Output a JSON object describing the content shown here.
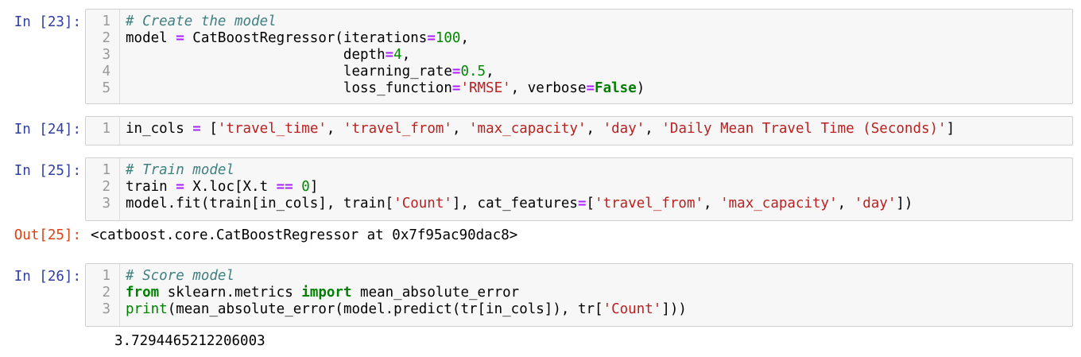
{
  "cells": {
    "c23": {
      "prompt": "In [23]:",
      "lines": [
        {
          "no": "1",
          "tokens": [
            {
              "t": "# Create the model",
              "c": "c-com"
            }
          ]
        },
        {
          "no": "2",
          "tokens": [
            {
              "t": "model ",
              "c": ""
            },
            {
              "t": "=",
              "c": "c-op"
            },
            {
              "t": " CatBoostRegressor(iterations",
              "c": ""
            },
            {
              "t": "=",
              "c": "c-op"
            },
            {
              "t": "100",
              "c": "c-num"
            },
            {
              "t": ",",
              "c": ""
            }
          ]
        },
        {
          "no": "3",
          "tokens": [
            {
              "t": "                          depth",
              "c": ""
            },
            {
              "t": "=",
              "c": "c-op"
            },
            {
              "t": "4",
              "c": "c-num"
            },
            {
              "t": ",",
              "c": ""
            }
          ]
        },
        {
          "no": "4",
          "tokens": [
            {
              "t": "                          learning_rate",
              "c": ""
            },
            {
              "t": "=",
              "c": "c-op"
            },
            {
              "t": "0.5",
              "c": "c-num"
            },
            {
              "t": ",",
              "c": ""
            }
          ]
        },
        {
          "no": "5",
          "tokens": [
            {
              "t": "                          loss_function",
              "c": ""
            },
            {
              "t": "=",
              "c": "c-op"
            },
            {
              "t": "'RMSE'",
              "c": "c-str"
            },
            {
              "t": ", verbose",
              "c": ""
            },
            {
              "t": "=",
              "c": "c-op"
            },
            {
              "t": "False",
              "c": "c-kw"
            },
            {
              "t": ")",
              "c": ""
            }
          ]
        }
      ]
    },
    "c24": {
      "prompt": "In [24]:",
      "lines": [
        {
          "no": "1",
          "tokens": [
            {
              "t": "in_cols ",
              "c": ""
            },
            {
              "t": "=",
              "c": "c-op"
            },
            {
              "t": " [",
              "c": ""
            },
            {
              "t": "'travel_time'",
              "c": "c-str"
            },
            {
              "t": ", ",
              "c": ""
            },
            {
              "t": "'travel_from'",
              "c": "c-str"
            },
            {
              "t": ", ",
              "c": ""
            },
            {
              "t": "'max_capacity'",
              "c": "c-str"
            },
            {
              "t": ", ",
              "c": ""
            },
            {
              "t": "'day'",
              "c": "c-str"
            },
            {
              "t": ", ",
              "c": ""
            },
            {
              "t": "'Daily Mean Travel Time (Seconds)'",
              "c": "c-str"
            },
            {
              "t": "]",
              "c": ""
            }
          ]
        }
      ]
    },
    "c25": {
      "prompt": "In [25]:",
      "lines": [
        {
          "no": "1",
          "tokens": [
            {
              "t": "# Train model",
              "c": "c-com"
            }
          ]
        },
        {
          "no": "2",
          "tokens": [
            {
              "t": "train ",
              "c": ""
            },
            {
              "t": "=",
              "c": "c-op"
            },
            {
              "t": " X.loc[X.t ",
              "c": ""
            },
            {
              "t": "==",
              "c": "c-op"
            },
            {
              "t": " ",
              "c": ""
            },
            {
              "t": "0",
              "c": "c-num"
            },
            {
              "t": "]",
              "c": ""
            }
          ]
        },
        {
          "no": "3",
          "tokens": [
            {
              "t": "model.fit(train[in_cols], train[",
              "c": ""
            },
            {
              "t": "'Count'",
              "c": "c-str"
            },
            {
              "t": "], cat_features",
              "c": ""
            },
            {
              "t": "=",
              "c": "c-op"
            },
            {
              "t": "[",
              "c": ""
            },
            {
              "t": "'travel_from'",
              "c": "c-str"
            },
            {
              "t": ", ",
              "c": ""
            },
            {
              "t": "'max_capacity'",
              "c": "c-str"
            },
            {
              "t": ", ",
              "c": ""
            },
            {
              "t": "'day'",
              "c": "c-str"
            },
            {
              "t": "])",
              "c": ""
            }
          ]
        }
      ]
    },
    "out25": {
      "prompt": "Out[25]:",
      "text": "<catboost.core.CatBoostRegressor at 0x7f95ac90dac8>"
    },
    "c26": {
      "prompt": "In [26]:",
      "lines": [
        {
          "no": "1",
          "tokens": [
            {
              "t": "# Score model",
              "c": "c-com"
            }
          ]
        },
        {
          "no": "2",
          "tokens": [
            {
              "t": "from",
              "c": "c-kw"
            },
            {
              "t": " sklearn.metrics ",
              "c": ""
            },
            {
              "t": "import",
              "c": "c-kw"
            },
            {
              "t": " mean_absolute_error",
              "c": ""
            }
          ]
        },
        {
          "no": "3",
          "tokens": [
            {
              "t": "print",
              "c": "c-bi"
            },
            {
              "t": "(mean_absolute_error(model.predict(tr[in_cols]), tr[",
              "c": ""
            },
            {
              "t": "'Count'",
              "c": "c-str"
            },
            {
              "t": "]))",
              "c": ""
            }
          ]
        }
      ]
    },
    "stdout26": {
      "text": "3.7294465212206003"
    }
  }
}
